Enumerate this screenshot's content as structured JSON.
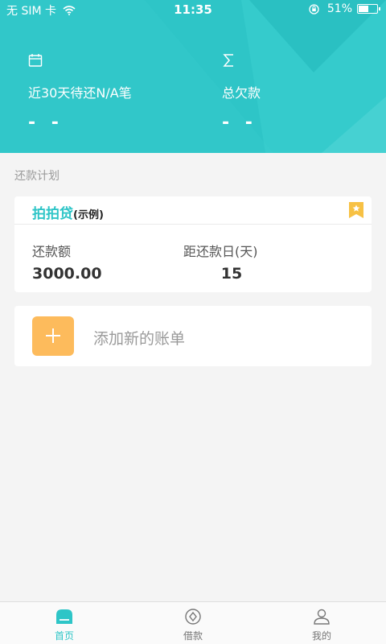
{
  "status_bar": {
    "carrier": "无 SIM 卡",
    "time": "11:35",
    "battery": "51%",
    "battery_level": 0.51
  },
  "summary": {
    "pending_label": "近30天待还N/A笔",
    "pending_value": "- -",
    "total_label": "总欠款",
    "total_value": "- -"
  },
  "section_title": "还款计划",
  "plan_card": {
    "name": "拍拍贷",
    "tag": "(示例)",
    "amount_label": "还款额",
    "amount_value": "3000.00",
    "days_label": "距还款日(天)",
    "days_value": "15"
  },
  "add_card": {
    "label": "添加新的账单"
  },
  "tabs": [
    {
      "label": "首页",
      "active": true
    },
    {
      "label": "借款",
      "active": false
    },
    {
      "label": "我的",
      "active": false
    }
  ],
  "colors": {
    "accent": "#2ec5c7",
    "orange": "#fdbb5c",
    "bookmark": "#f7c144"
  },
  "icons": {
    "pending": "calendar-icon",
    "total": "sigma-icon",
    "bookmark": "bookmark-star-icon",
    "add": "plus-icon",
    "tab_home": "home-icon",
    "tab_loan": "coin-icon",
    "tab_me": "person-icon"
  }
}
